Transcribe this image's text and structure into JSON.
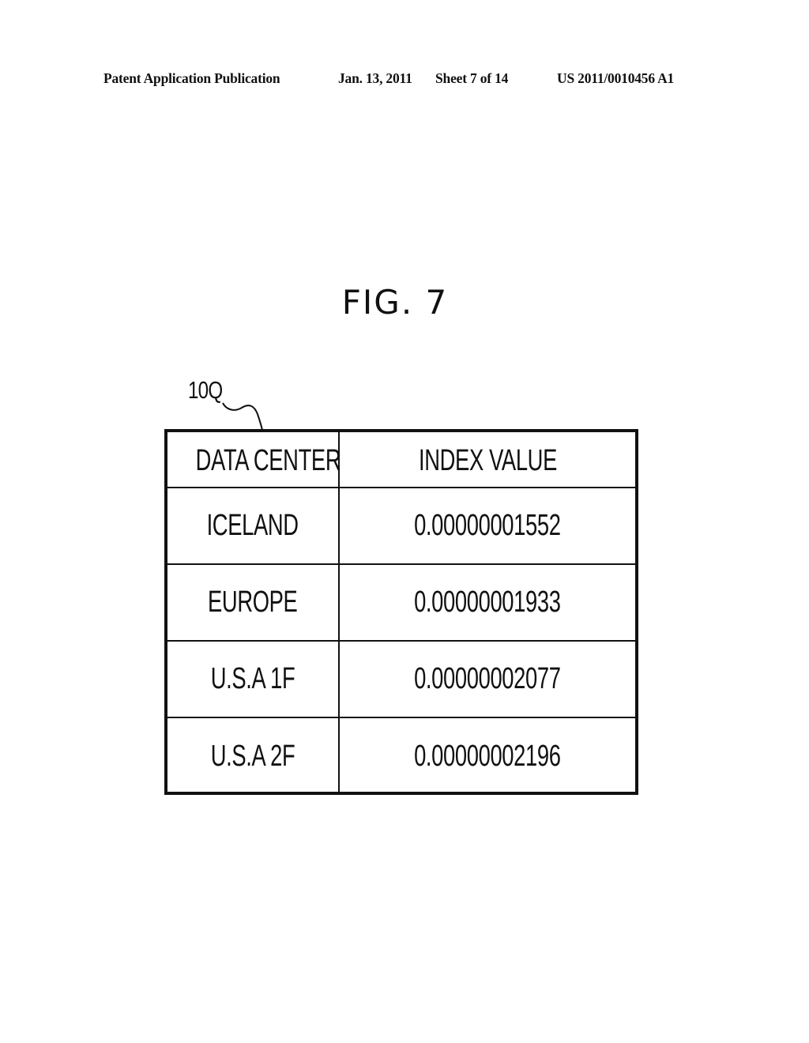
{
  "header": {
    "publication": "Patent Application Publication",
    "date": "Jan. 13, 2011",
    "sheet": "Sheet 7 of 14",
    "number": "US 2011/0010456 A1"
  },
  "figure": {
    "title": "FIG. 7",
    "reference_label": "10Q"
  },
  "table": {
    "columns": [
      "DATA CENTER",
      "INDEX VALUE"
    ],
    "rows": [
      {
        "data_center": "ICELAND",
        "index_value": "0.00000001552"
      },
      {
        "data_center": "EUROPE",
        "index_value": "0.00000001933"
      },
      {
        "data_center": "U.S.A 1F",
        "index_value": "0.00000002077"
      },
      {
        "data_center": "U.S.A 2F",
        "index_value": "0.00000002196"
      }
    ]
  }
}
